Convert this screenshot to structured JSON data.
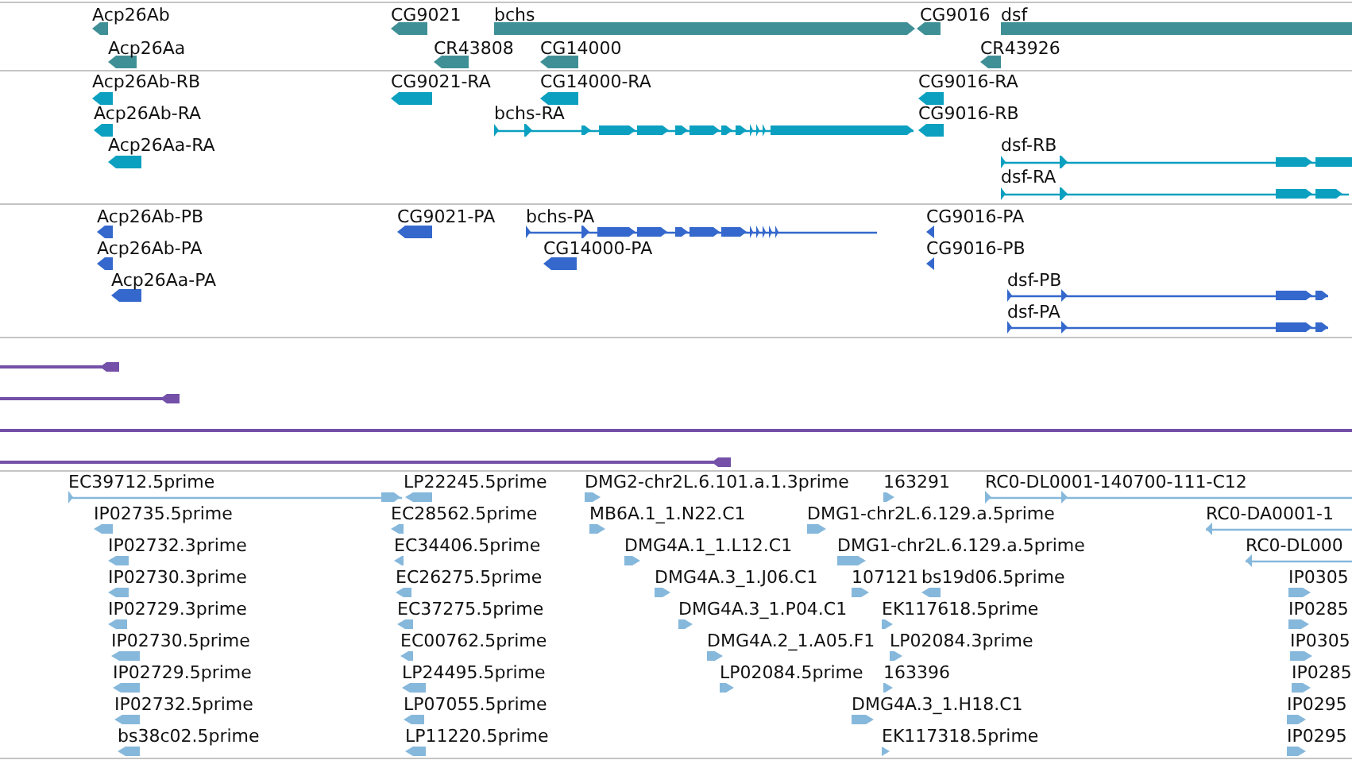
{
  "tracks": [
    {
      "kind": "genes",
      "color": "#3f9096",
      "features": [
        {
          "label": "Acp26Ab",
          "reverse": true
        },
        {
          "label": "CG9021",
          "reverse": true
        },
        {
          "label": "bchs",
          "reverse": false
        },
        {
          "label": "CG9016",
          "reverse": true
        },
        {
          "label": "dsf",
          "reverse": false
        },
        {
          "label": "Acp26Aa",
          "reverse": true
        },
        {
          "label": "CR43808",
          "reverse": true
        },
        {
          "label": "CG14000",
          "reverse": true
        },
        {
          "label": "CR43926",
          "reverse": true
        }
      ]
    },
    {
      "kind": "genes",
      "color": "#0ba0c0",
      "features": [
        {
          "label": "Acp26Ab-RB",
          "reverse": true
        },
        {
          "label": "CG9021-RA",
          "reverse": true
        },
        {
          "label": "CG14000-RA",
          "reverse": true
        },
        {
          "label": "CG9016-RA",
          "reverse": true
        },
        {
          "label": "Acp26Ab-RA",
          "reverse": true
        },
        {
          "label": "bchs-RA",
          "reverse": false
        },
        {
          "label": "CG9016-RB",
          "reverse": true
        },
        {
          "label": "Acp26Aa-RA",
          "reverse": true
        },
        {
          "label": "dsf-RB",
          "reverse": false
        },
        {
          "label": "dsf-RA",
          "reverse": false
        }
      ]
    },
    {
      "kind": "genes",
      "color": "#3468cc",
      "features": [
        {
          "label": "Acp26Ab-PB",
          "reverse": true
        },
        {
          "label": "CG9021-PA",
          "reverse": true
        },
        {
          "label": "bchs-PA",
          "reverse": false
        },
        {
          "label": "CG9016-PA",
          "reverse": true
        },
        {
          "label": "Acp26Ab-PA",
          "reverse": true
        },
        {
          "label": "CG14000-PA",
          "reverse": true
        },
        {
          "label": "CG9016-PB",
          "reverse": true
        },
        {
          "label": "Acp26Aa-PA",
          "reverse": true
        },
        {
          "label": "dsf-PB",
          "reverse": false
        },
        {
          "label": "dsf-PA",
          "reverse": false
        }
      ]
    },
    {
      "kind": "lines",
      "color": "#7450a8",
      "features": [
        {
          "kind": "end",
          "reverse": true
        },
        {
          "kind": "end",
          "reverse": true
        },
        {
          "kind": "span"
        },
        {
          "kind": "end",
          "reverse": true
        }
      ]
    },
    {
      "kind": "genes",
      "color": "#86b8dc",
      "features": [
        {
          "label": "EC39712.5prime",
          "reverse": false
        },
        {
          "label": "LP22245.5prime",
          "reverse": true
        },
        {
          "label": "DMG2-chr2L.6.101.a.1.3prime",
          "reverse": false
        },
        {
          "label": "163291",
          "reverse": false
        },
        {
          "label": "RC0-DL0001-140700-111-C12",
          "reverse": false
        },
        {
          "label": "IP02735.5prime",
          "reverse": true
        },
        {
          "label": "EC28562.5prime",
          "reverse": true
        },
        {
          "label": "MB6A.1_1.N22.C1",
          "reverse": false
        },
        {
          "label": "DMG1-chr2L.6.129.a.5prime",
          "reverse": false
        },
        {
          "label": "RC0-DA0001-1",
          "reverse": true
        },
        {
          "label": "IP02732.3prime",
          "reverse": true
        },
        {
          "label": "EC34406.5prime",
          "reverse": true
        },
        {
          "label": "DMG4A.1_1.L12.C1",
          "reverse": false
        },
        {
          "label": "DMG1-chr2L.6.129.a.5prime",
          "reverse": false
        },
        {
          "label": "RC0-DL000",
          "reverse": true
        },
        {
          "label": "IP02730.3prime",
          "reverse": true
        },
        {
          "label": "EC26275.5prime",
          "reverse": true
        },
        {
          "label": "DMG4A.3_1.J06.C1",
          "reverse": false
        },
        {
          "label": "107121",
          "reverse": false
        },
        {
          "label": "bs19d06.5prime",
          "reverse": true
        },
        {
          "label": "IP0305",
          "reverse": false
        },
        {
          "label": "IP02729.3prime",
          "reverse": true
        },
        {
          "label": "EC37275.5prime",
          "reverse": true
        },
        {
          "label": "DMG4A.3_1.P04.C1",
          "reverse": false
        },
        {
          "label": "EK117618.5prime",
          "reverse": false
        },
        {
          "label": "IP0285",
          "reverse": false
        },
        {
          "label": "IP02730.5prime",
          "reverse": true
        },
        {
          "label": "EC00762.5prime",
          "reverse": true
        },
        {
          "label": "DMG4A.2_1.A05.F1",
          "reverse": false
        },
        {
          "label": "LP02084.3prime",
          "reverse": false
        },
        {
          "label": "IP0305",
          "reverse": false
        },
        {
          "label": "IP02729.5prime",
          "reverse": true
        },
        {
          "label": "LP24495.5prime",
          "reverse": true
        },
        {
          "label": "LP02084.5prime",
          "reverse": false
        },
        {
          "label": "163396",
          "reverse": false
        },
        {
          "label": "IP0285",
          "reverse": false
        },
        {
          "label": "IP02732.5prime",
          "reverse": true
        },
        {
          "label": "LP07055.5prime",
          "reverse": true
        },
        {
          "label": "DMG4A.3_1.H18.C1",
          "reverse": false
        },
        {
          "label": "IP0295",
          "reverse": false
        },
        {
          "label": "bs38c02.5prime",
          "reverse": true
        },
        {
          "label": "LP11220.5prime",
          "reverse": true
        },
        {
          "label": "EK117318.5prime",
          "reverse": false
        },
        {
          "label": "IP0295",
          "reverse": false
        }
      ]
    }
  ]
}
